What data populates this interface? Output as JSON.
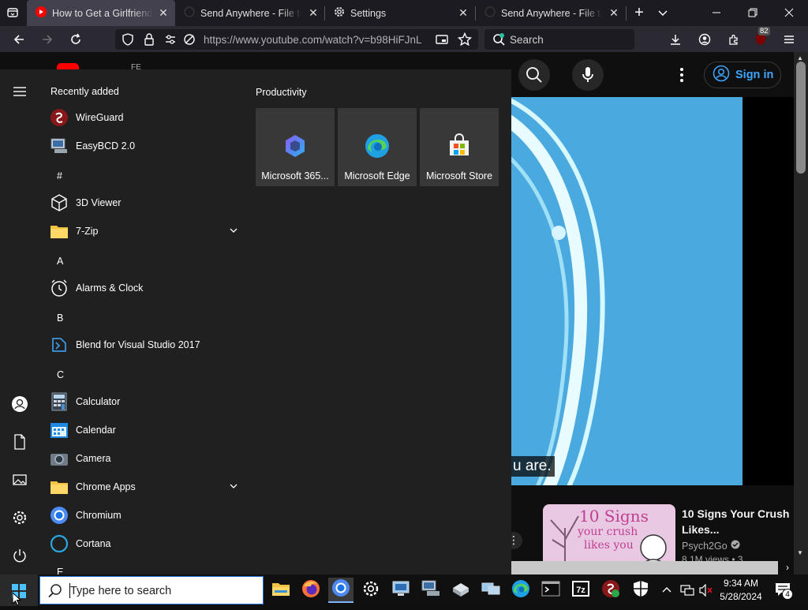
{
  "browser": {
    "tabs": [
      {
        "title": "How to Get a Girlfriend in",
        "active": true,
        "icon": "youtube-icon"
      },
      {
        "title": "Send Anywhere - File tran",
        "active": false,
        "icon": "send-anywhere-icon"
      },
      {
        "title": "Settings",
        "active": false,
        "icon": "gear-icon"
      },
      {
        "title": "Send Anywhere - File tran",
        "active": false,
        "icon": "send-anywhere-icon"
      }
    ],
    "url": "https://www.youtube.com/watch?v=b98HiFJnL",
    "search_placeholder": "Search",
    "extension_badge": "82"
  },
  "youtube": {
    "sign_in": "Sign in",
    "caption": "u are.",
    "logo_suffix": "FE",
    "recommended": {
      "title": "10 Signs Your Crush Likes...",
      "channel": "Psych2Go",
      "views": "8.1M views • 3",
      "thumb_text_1": "10 Signs",
      "thumb_text_2": "your crush",
      "thumb_text_3": "likes you"
    }
  },
  "start_menu": {
    "recently_added_label": "Recently added",
    "productivity_label": "Productivity",
    "apps": {
      "wireguard": "WireGuard",
      "easybcd": "EasyBCD 2.0",
      "hdr_hash": "#",
      "viewer3d": "3D Viewer",
      "zip7": "7-Zip",
      "hdr_a": "A",
      "alarms": "Alarms & Clock",
      "hdr_b": "B",
      "blend": "Blend for Visual Studio 2017",
      "hdr_c": "C",
      "calculator": "Calculator",
      "calendar": "Calendar",
      "camera": "Camera",
      "chrome_apps": "Chrome Apps",
      "chromium": "Chromium",
      "cortana": "Cortana",
      "hdr_e": "E"
    },
    "tiles": {
      "m365": "Microsoft 365...",
      "edge": "Microsoft Edge",
      "store": "Microsoft Store"
    }
  },
  "taskbar": {
    "search_placeholder": "Type here to search",
    "time": "9:34 AM",
    "date": "5/28/2024",
    "notification_count": "4"
  },
  "colors": {
    "accent_blue": "#3ea6ff",
    "start_bg": "#202020",
    "video_bg": "#4aa9de"
  }
}
